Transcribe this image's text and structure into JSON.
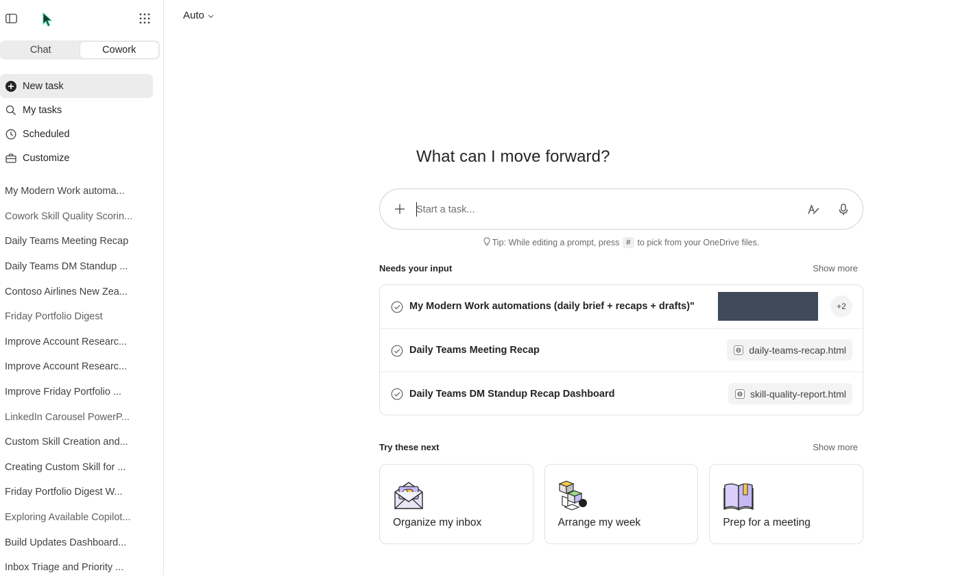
{
  "sidebar": {
    "mode_tabs": [
      {
        "label": "Chat",
        "active": false
      },
      {
        "label": "Cowork",
        "active": true
      }
    ],
    "nav": [
      {
        "label": "New task",
        "icon": "plus-circle-icon",
        "active": true
      },
      {
        "label": "My tasks",
        "icon": "search-icon",
        "active": false
      },
      {
        "label": "Scheduled",
        "icon": "clock-icon",
        "active": false
      },
      {
        "label": "Customize",
        "icon": "briefcase-icon",
        "active": false
      }
    ],
    "recents": [
      "My Modern Work automa...",
      "Cowork Skill Quality Scorin...",
      "Daily Teams Meeting Recap",
      "Daily Teams DM Standup ...",
      "Contoso Airlines New Zea...",
      "Friday Portfolio Digest",
      "Improve Account Researc...",
      "Improve Account Researc...",
      "Improve Friday Portfolio ...",
      "LinkedIn Carousel PowerP...",
      "Custom Skill Creation and...",
      "Creating Custom Skill for ...",
      "Friday Portfolio Digest W...",
      "Exploring Available Copilot...",
      "Build Updates Dashboard...",
      "Inbox Triage and Priority ..."
    ]
  },
  "header": {
    "model": "Auto"
  },
  "main": {
    "greeting": "What can I move forward?",
    "composer": {
      "placeholder": "Start a task..."
    },
    "tip": {
      "before": "Tip: While editing a prompt, press",
      "key": "#",
      "after": "to pick from your OneDrive files."
    },
    "needs_input": {
      "title": "Needs your input",
      "show_more": "Show more",
      "items": [
        {
          "title": "My Modern Work automations (daily brief + recaps + drafts)\"",
          "extra": "+2"
        },
        {
          "title": "Daily Teams Meeting Recap",
          "file": "daily-teams-recap.html"
        },
        {
          "title": "Daily Teams DM Standup Recap Dashboard",
          "file": "skill-quality-report.html"
        }
      ]
    },
    "try_next": {
      "title": "Try these next",
      "show_more": "Show more",
      "cards": [
        {
          "label": "Organize my inbox",
          "icon": "envelope-icon"
        },
        {
          "label": "Arrange my week",
          "icon": "blocks-icon"
        },
        {
          "label": "Prep for a meeting",
          "icon": "book-icon"
        }
      ]
    }
  },
  "colors": {
    "accent_purple": "#c7b8f5",
    "redaction": "#3f4a5a",
    "active_bg": "#ececec"
  }
}
